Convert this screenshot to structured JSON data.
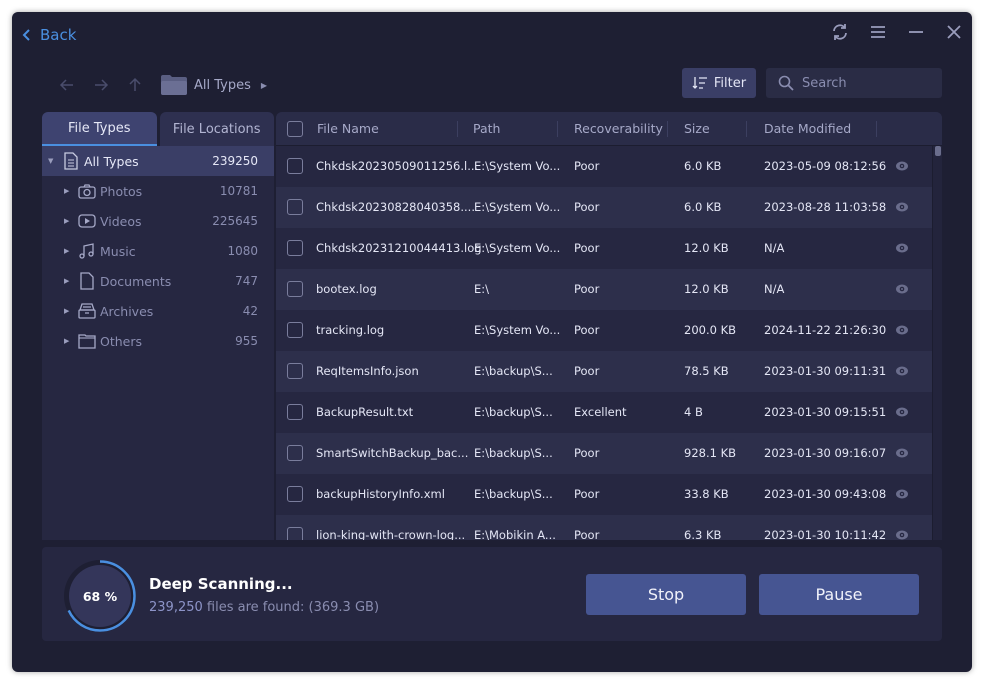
{
  "header": {
    "back_label": "Back",
    "window_controls": [
      "refresh-icon",
      "menu-icon",
      "minimize-icon",
      "close-icon"
    ]
  },
  "navigation": {
    "breadcrumb_label": "All Types",
    "buttons": [
      "back-arrow-icon",
      "forward-arrow-icon",
      "up-arrow-icon"
    ]
  },
  "toolbar": {
    "filter_label": "Filter",
    "search_placeholder": "Search",
    "search_value": ""
  },
  "sidebar": {
    "tabs": [
      {
        "label": "File Types",
        "active": true
      },
      {
        "label": "File Locations",
        "active": false
      }
    ],
    "items": [
      {
        "label": "All Types",
        "count": "239250",
        "icon": "document-icon",
        "expanded": true,
        "selected": true
      },
      {
        "label": "Photos",
        "count": "10781",
        "icon": "camera-icon"
      },
      {
        "label": "Videos",
        "count": "225645",
        "icon": "video-icon"
      },
      {
        "label": "Music",
        "count": "1080",
        "icon": "music-icon"
      },
      {
        "label": "Documents",
        "count": "747",
        "icon": "file-icon"
      },
      {
        "label": "Archives",
        "count": "42",
        "icon": "archive-icon"
      },
      {
        "label": "Others",
        "count": "955",
        "icon": "folder-icon"
      }
    ]
  },
  "table": {
    "columns": [
      "File Name",
      "Path",
      "Recoverability",
      "Size",
      "Date Modified"
    ],
    "rows": [
      {
        "name": "Chkdsk20230509011256.l...",
        "path": "E:\\System Vo...",
        "recoverability": "Poor",
        "size": "6.0 KB",
        "date": "2023-05-09 08:12:56"
      },
      {
        "name": "Chkdsk20230828040358....",
        "path": "E:\\System Vo...",
        "recoverability": "Poor",
        "size": "6.0 KB",
        "date": "2023-08-28 11:03:58"
      },
      {
        "name": "Chkdsk20231210044413.log",
        "path": "E:\\System Vo...",
        "recoverability": "Poor",
        "size": "12.0 KB",
        "date": "N/A"
      },
      {
        "name": "bootex.log",
        "path": "E:\\",
        "recoverability": "Poor",
        "size": "12.0 KB",
        "date": "N/A"
      },
      {
        "name": "tracking.log",
        "path": "E:\\System Vo...",
        "recoverability": "Poor",
        "size": "200.0 KB",
        "date": "2024-11-22 21:26:30"
      },
      {
        "name": "ReqItemsInfo.json",
        "path": "E:\\backup\\S...",
        "recoverability": "Poor",
        "size": "78.5 KB",
        "date": "2023-01-30 09:11:31"
      },
      {
        "name": "BackupResult.txt",
        "path": "E:\\backup\\S...",
        "recoverability": "Excellent",
        "size": "4 B",
        "date": "2023-01-30 09:15:51"
      },
      {
        "name": "SmartSwitchBackup_bac...",
        "path": "E:\\backup\\S...",
        "recoverability": "Poor",
        "size": "928.1 KB",
        "date": "2023-01-30 09:16:07"
      },
      {
        "name": "backupHistoryInfo.xml",
        "path": "E:\\backup\\S...",
        "recoverability": "Poor",
        "size": "33.8 KB",
        "date": "2023-01-30 09:43:08"
      },
      {
        "name": "lion-king-with-crown-log...",
        "path": "E:\\Mobikin A...",
        "recoverability": "Poor",
        "size": "6.3 KB",
        "date": "2023-01-30 10:11:42"
      }
    ]
  },
  "scan": {
    "progress_percent": 68,
    "progress_label": "68 %",
    "title": "Deep Scanning...",
    "files_found": "239,250",
    "files_suffix": " files are found: (369.3 GB)",
    "stop_label": "Stop",
    "pause_label": "Pause"
  },
  "colors": {
    "accent": "#4a8fe0",
    "background": "#1e1f33",
    "panel": "#262741",
    "button": "#465592"
  }
}
